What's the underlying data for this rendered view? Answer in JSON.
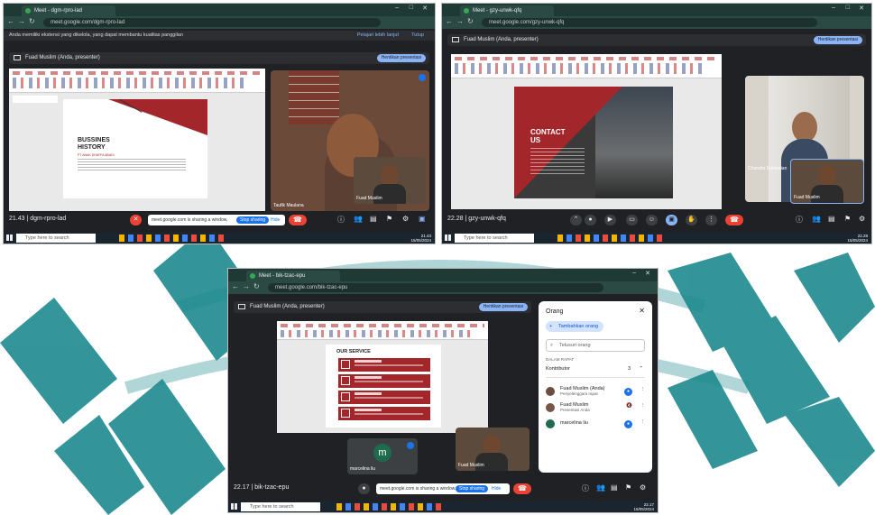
{
  "colors": {
    "teal": "#1e8a8f",
    "meet_bg": "#202124",
    "red_slide": "#a3262a",
    "accent_blue": "#8ab4f8",
    "end_call": "#ea4335"
  },
  "shot1": {
    "tab_title": "Meet - dgm-rpro-lad",
    "url": "meet.google.com/dgm-rpro-lad",
    "notice": "Anda memiliki ekstensi yang dikelola, yang dapat membantu kualitas panggilan",
    "notice_link1": "Pelajari lebih lanjut",
    "notice_link2": "Tutup",
    "presenter_label": "Fuad Muslim (Anda, presenter)",
    "stop_presenting": "Hentikan presentasi",
    "slide_title1": "BUSSINES",
    "slide_title2": "HISTORY",
    "slide_subtitle": "PT ANAK DHAFFA ABADI",
    "tile_name": "Taufik Maulana",
    "self_name": "Fuad Muslim",
    "time_code": "21.43 | dgm-rpro-lad",
    "share_msg": "meet.google.com is sharing a window.",
    "stop_sharing": "Stop sharing",
    "hide": "Hide",
    "search": "Type here to search",
    "clock": "21.43",
    "date": "15/05/2024"
  },
  "shot2": {
    "tab_title": "Meet - gzy-unwk-qfq",
    "url": "meet.google.com/gzy-unwk-qfq",
    "presenter_label": "Fuad Muslim (Anda, presenter)",
    "stop_presenting": "Hentikan presentasi",
    "slide_title1": "CONTACT",
    "slide_title2": "US",
    "tile_name": "Chandra Dumpaian",
    "self_name": "Fuad Muslim",
    "time_code": "22.28 | gzy-unwk-qfq",
    "search": "Type here to search",
    "clock": "22.28",
    "date": "15/05/2024"
  },
  "shot3": {
    "tab_title": "Meet - bik-tzac-epu",
    "url": "meet.google.com/bik-tzac-epu",
    "presenter_label": "Fuad Muslim (Anda, presenter)",
    "stop_presenting": "Hentikan presentasi",
    "slide_title": "OUR SERVICE",
    "tile_name": "marcelina liu",
    "tile_avatar": "m",
    "self_name": "Fuad Muslim",
    "time_code": "22.17 | bik-tzac-epu",
    "share_msg": "meet.google.com is sharing a window.",
    "stop_sharing": "Stop sharing",
    "hide": "Hide",
    "search": "Type here to search",
    "clock": "22.17",
    "date": "15/05/2024",
    "people": {
      "title": "Orang",
      "add": "Tambahkan orang",
      "search_placeholder": "Telusuri orang",
      "section": "DALAM RAPAT",
      "contrib": "Kontributor",
      "count": "3",
      "members": [
        {
          "name": "Fuad Muslim (Anda)",
          "role": "Penyelenggara rapat",
          "color": "#6d4c41"
        },
        {
          "name": "Fuad Muslim",
          "role": "Presentasi Anda",
          "color": "#795548"
        },
        {
          "name": "marcelina liu",
          "role": "",
          "color": "#1e6b4e"
        }
      ]
    }
  }
}
